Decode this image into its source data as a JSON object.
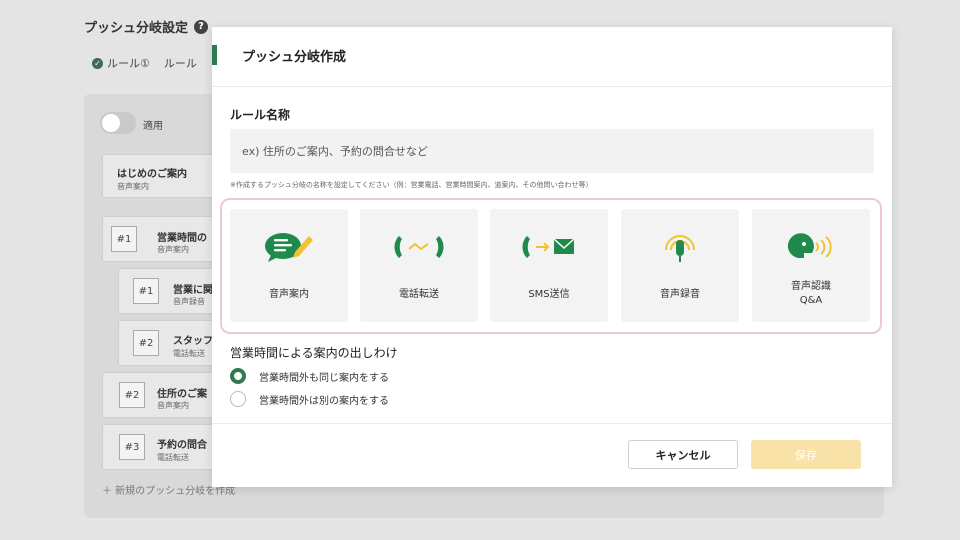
{
  "background": {
    "title": "プッシュ分岐設定",
    "help_icon": "?",
    "tabs": [
      {
        "label": "ルール①",
        "icon": "check-circle-icon"
      },
      {
        "label": "ルール"
      }
    ],
    "toggle_label": "適用",
    "cards": [
      {
        "title": "はじめのご案内",
        "sub": "音声案内"
      },
      {
        "num": "#1",
        "title": "営業時間の",
        "sub": "音声案内"
      },
      {
        "num": "#1",
        "title": "営業に関",
        "sub": "音声録音"
      },
      {
        "num": "#2",
        "title": "スタッフ",
        "sub": "電話転送"
      },
      {
        "num": "#2",
        "title": "住所のご案",
        "sub": "音声案内"
      },
      {
        "num": "#3",
        "title": "予約の問合",
        "sub": "電話転送"
      }
    ],
    "new_link": "＋  新規のプッシュ分岐を作成"
  },
  "modal": {
    "title": "プッシュ分岐作成",
    "rule_name_label": "ルール名称",
    "rule_name_placeholder": "ex) 住所のご案内、予約の問合せなど",
    "help_text": "※作成するプッシュ分岐の名称を設定してください（例：営業電話、営業時間案内、道案内、その他問い合わせ等）",
    "types": [
      {
        "label": "音声案内",
        "icon": "speech-bubble-pen-icon"
      },
      {
        "label": "電話転送",
        "icon": "phone-transfer-icon"
      },
      {
        "label": "SMS送信",
        "icon": "phone-sms-icon"
      },
      {
        "label": "音声録音",
        "icon": "microphone-icon"
      },
      {
        "label": "音声認識",
        "label2": "Q&A",
        "icon": "voice-recognition-icon"
      }
    ],
    "distribution_label": "営業時間による案内の出しわけ",
    "options": [
      {
        "label": "営業時間外も同じ案内をする",
        "selected": true
      },
      {
        "label": "営業時間外は別の案内をする",
        "selected": false
      }
    ],
    "cancel_label": "キャンセル",
    "save_label": "保存"
  },
  "colors": {
    "accent": "#2f7a4f",
    "icon_green": "#1f8a4c",
    "icon_yellow": "#f2c230",
    "highlight_border": "#f0c9cc",
    "save_disabled": "#f8e2a8"
  }
}
